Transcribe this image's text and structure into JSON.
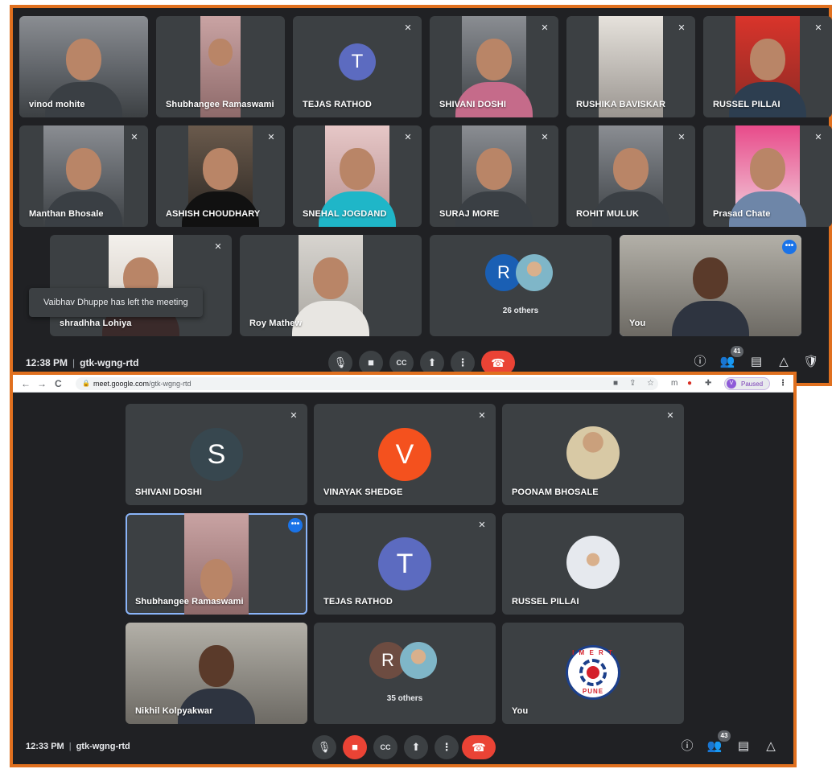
{
  "top": {
    "participants_row1": [
      {
        "name": "vinod mohite"
      },
      {
        "name": "Shubhangee Ramaswami"
      },
      {
        "name": "TEJAS RATHOD",
        "initial": "T"
      },
      {
        "name": "SHIVANI DOSHI"
      },
      {
        "name": "RUSHIKA BAVISKAR"
      },
      {
        "name": "RUSSEL PILLAI"
      }
    ],
    "participants_row2": [
      {
        "name": "Manthan Bhosale"
      },
      {
        "name": "ASHISH CHOUDHARY"
      },
      {
        "name": "SNEHAL JOGDAND"
      },
      {
        "name": "SURAJ MORE"
      },
      {
        "name": "ROHIT MULUK"
      },
      {
        "name": "Prasad Chate"
      }
    ],
    "participants_row3": [
      {
        "name": "shradhha Lohiya"
      },
      {
        "name": "Roy Mathew"
      },
      {
        "name": "",
        "others_label": "26 others",
        "initial": "R"
      },
      {
        "name": "You"
      }
    ],
    "toast": "Vaibhav Dhuppe has left the meeting",
    "time": "12:38 PM",
    "meeting_code": "gtk-wgng-rtd",
    "people_count": "41"
  },
  "bottom": {
    "browser": {
      "url_host": "meet.google.com",
      "url_path": "/gtk-wgng-rtd",
      "profile_initial": "V",
      "profile_status": "Paused"
    },
    "participants": [
      {
        "name": "SHIVANI DOSHI",
        "initial": "S"
      },
      {
        "name": "VINAYAK SHEDGE",
        "initial": "V"
      },
      {
        "name": "POONAM BHOSALE"
      },
      {
        "name": "Shubhangee Ramaswami"
      },
      {
        "name": "TEJAS RATHOD",
        "initial": "T"
      },
      {
        "name": "RUSSEL PILLAI"
      },
      {
        "name": "Nikhil Kolpyakwar"
      },
      {
        "name": "",
        "others_label": "35 others",
        "initial": "R"
      },
      {
        "name": "You",
        "logo_top": "I M E R T",
        "logo_bottom": "PUNE"
      }
    ],
    "time": "12:33 PM",
    "meeting_code": "gtk-wgng-rtd",
    "people_count": "43"
  },
  "colors": {
    "frame": "#e0701f",
    "meet_bg": "#202124",
    "tile_bg": "#3c4043",
    "end_call": "#ea4335",
    "avatar_T": "#5c6bc0",
    "avatar_S": "#37474f",
    "avatar_V": "#f4511e",
    "avatar_R_top": "#1a5fb4",
    "avatar_R_bottom": "#6d4c41"
  }
}
